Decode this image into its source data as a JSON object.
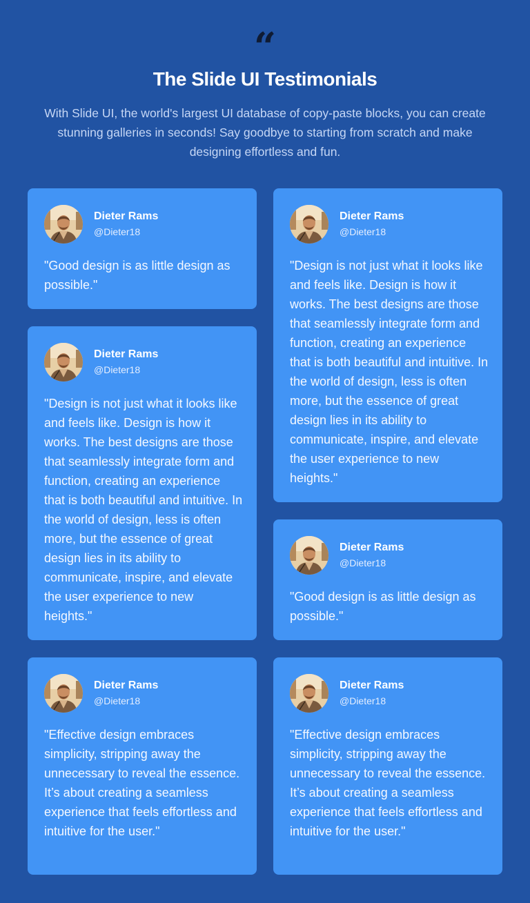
{
  "header": {
    "quote_icon": "quote-icon",
    "title": "The Slide UI Testimonials",
    "subtitle": "With Slide UI, the world's largest UI database of copy-paste blocks, you can create stunning galleries in seconds! Say goodbye to starting from scratch and make designing effortless and fun."
  },
  "testimonials": [
    {
      "name": "Dieter Rams",
      "handle": "@Dieter18",
      "quote": "\"Good design is as little design as possible.\""
    },
    {
      "name": "Dieter Rams",
      "handle": "@Dieter18",
      "quote": "\"Design is not just what it looks like and feels like. Design is how it works. The best designs are those that seamlessly integrate form and function, creating an experience that is both beautiful and intuitive. In the world of design, less is often more, but the essence of great design lies in its ability to communicate, inspire, and elevate the user experience to new heights.\""
    },
    {
      "name": "Dieter Rams",
      "handle": "@Dieter18",
      "quote": "\"Design is not just what it looks like and feels like. Design is how it works. The best designs are those that seamlessly integrate form and function, creating an experience that is both beautiful and intuitive. In the world of design, less is often more, but the essence of great design lies in its ability to communicate, inspire, and elevate the user experience to new heights.\""
    },
    {
      "name": "Dieter Rams",
      "handle": "@Dieter18",
      "quote": "\"Good design is as little design as possible.\""
    },
    {
      "name": "Dieter Rams",
      "handle": "@Dieter18",
      "quote": "\"Effective design embraces simplicity, stripping away the unnecessary to reveal the essence. It’s about creating a seamless experience that feels effortless and intuitive for the user.\""
    },
    {
      "name": "Dieter Rams",
      "handle": "@Dieter18",
      "quote": "\"Effective design embraces simplicity, stripping away the unnecessary to reveal the essence. It’s about creating a seamless experience that feels effortless and intuitive for the user.\""
    }
  ],
  "colors": {
    "background": "#2153a3",
    "card": "#4294f5",
    "quote_icon": "#0f1b33"
  }
}
